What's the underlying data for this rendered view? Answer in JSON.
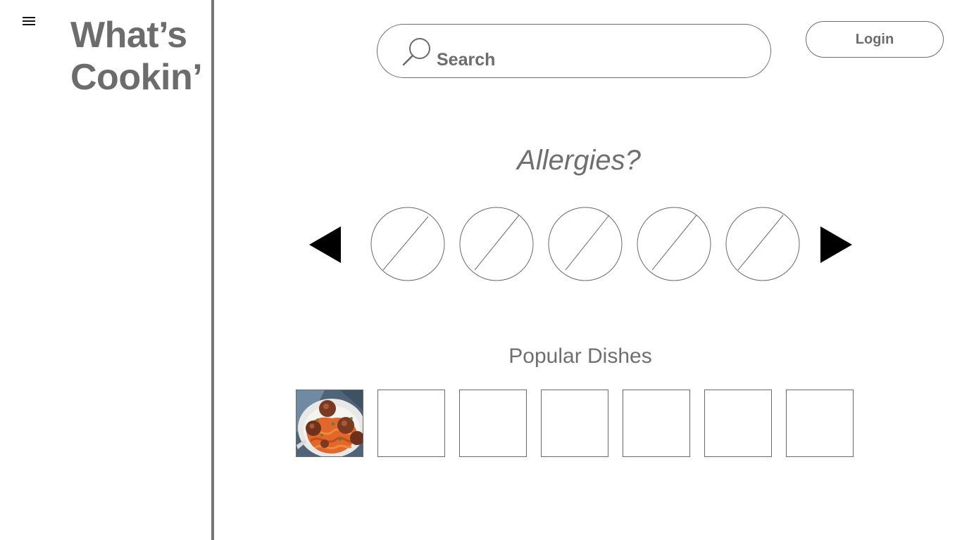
{
  "header": {
    "menu_icon": "hamburger-menu-icon",
    "title_line1": "What’s",
    "title_line2": "Cookin’"
  },
  "search": {
    "icon": "magnifier-icon",
    "label": "Search"
  },
  "login": {
    "label": "Login"
  },
  "allergies": {
    "title": "Allergies?",
    "prev_icon": "triangle-left-icon",
    "next_icon": "triangle-right-icon",
    "items": [
      {
        "icon": "image-placeholder-icon"
      },
      {
        "icon": "image-placeholder-icon"
      },
      {
        "icon": "image-placeholder-icon"
      },
      {
        "icon": "image-placeholder-icon"
      },
      {
        "icon": "image-placeholder-icon"
      }
    ]
  },
  "popular": {
    "title": "Popular Dishes",
    "dishes": [
      {
        "image": "spaghetti-and-meatballs-photo"
      },
      {
        "image": "empty-placeholder"
      },
      {
        "image": "empty-placeholder"
      },
      {
        "image": "empty-placeholder"
      },
      {
        "image": "empty-placeholder"
      },
      {
        "image": "empty-placeholder"
      },
      {
        "image": "empty-placeholder"
      }
    ]
  },
  "colors": {
    "text_gray": "#6f6f6f",
    "divider": "#757575",
    "outline": "#6a6a6a",
    "arrow": "#000000"
  }
}
